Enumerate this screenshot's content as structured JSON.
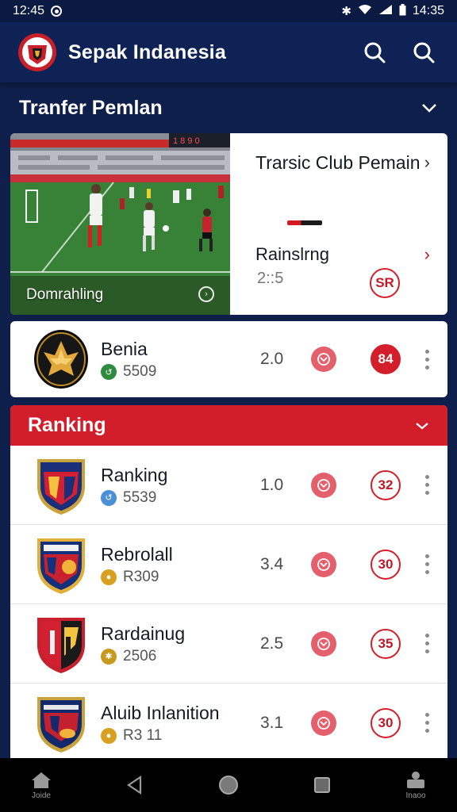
{
  "status_bar": {
    "time": "12:45",
    "right_time": "14:35"
  },
  "app": {
    "title": "Sepak Indanesia"
  },
  "transfer_section": {
    "title": "Tranfer Pemlan"
  },
  "featured": {
    "image_caption": "Domrahling",
    "scoreboard": "1 8 9 0",
    "title": "Trarsic Club Pemain",
    "subtitle": "Rainslrng",
    "score": "2::5",
    "badge": "SR"
  },
  "single_team": {
    "name": "Benia",
    "code": "5509",
    "rating": "2.0",
    "badge": "84"
  },
  "ranking": {
    "title": "Ranking",
    "teams": [
      {
        "name": "Ranking",
        "code": "5539",
        "rating": "1.0",
        "badge": "32",
        "meta_color": "#4a8fd8"
      },
      {
        "name": "Rebrolall",
        "code": "R309",
        "rating": "3.4",
        "badge": "30",
        "meta_color": "#d7a020"
      },
      {
        "name": "Rardainug",
        "code": "2506",
        "rating": "2.5",
        "badge": "35",
        "meta_color": "#c79a1d"
      },
      {
        "name": "Aluib Inlanition",
        "code": "R3 11",
        "rating": "3.1",
        "badge": "30",
        "meta_color": "#d7a020"
      }
    ]
  },
  "bottom_nav": {
    "home_label": "Joide",
    "profile_label": "Inaoo"
  }
}
